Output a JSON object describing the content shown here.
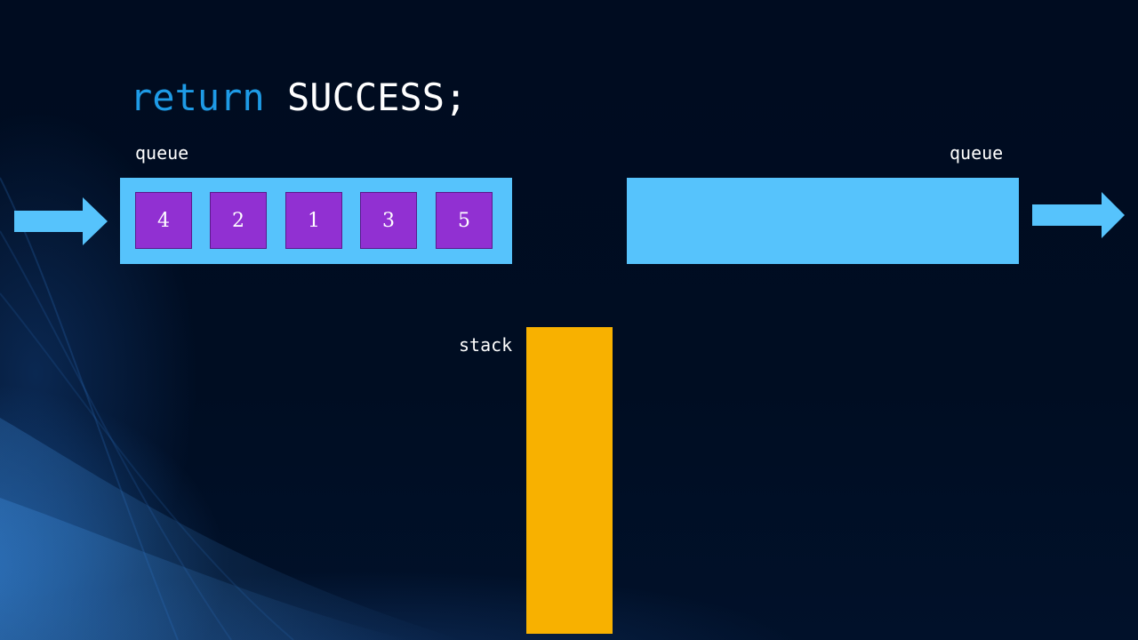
{
  "code": {
    "keyword": "return",
    "rest": " SUCCESS;"
  },
  "input_queue": {
    "label": "queue",
    "items": [
      "4",
      "2",
      "1",
      "3",
      "5"
    ]
  },
  "output_queue": {
    "label": "queue",
    "items": []
  },
  "stack": {
    "label": "stack",
    "items": []
  },
  "colors": {
    "background": "#000d22",
    "keyword": "#1e9be6",
    "queue": "#56c3fc",
    "queue_item": "#9130d2",
    "stack": "#f8b100"
  },
  "icons": {
    "input_arrow": "right-arrow-icon",
    "output_arrow": "right-arrow-icon"
  }
}
